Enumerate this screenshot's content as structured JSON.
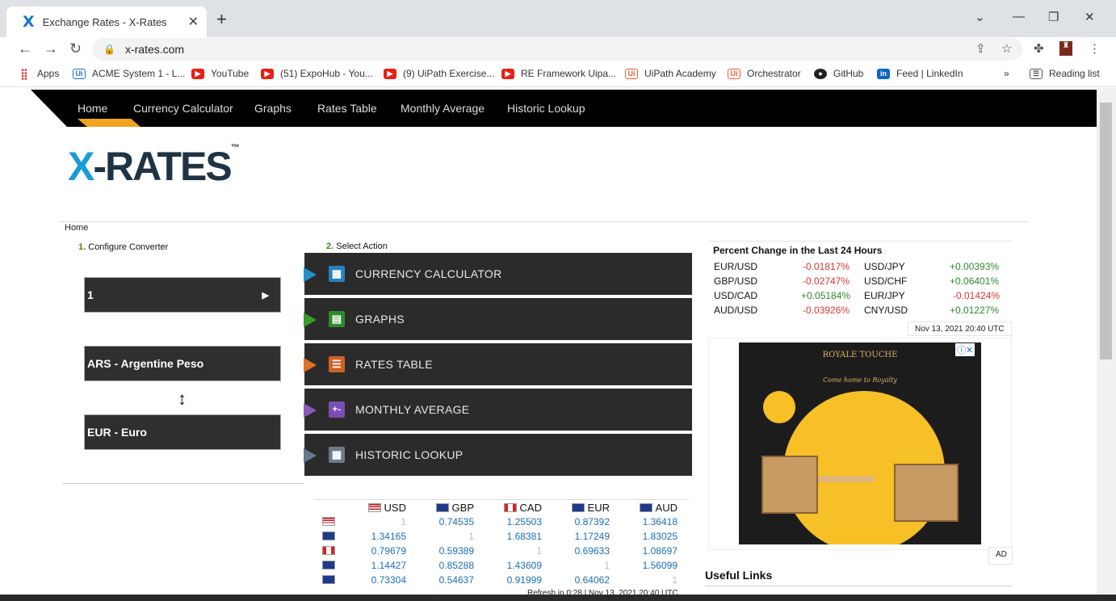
{
  "browser": {
    "tab_title": "Exchange Rates - X-Rates",
    "tab_logo": "X",
    "url": "x-rates.com",
    "bookmarks": [
      {
        "label": "Apps",
        "icon": "apps"
      },
      {
        "label": "ACME System 1 - L...",
        "icon": "ui2"
      },
      {
        "label": "YouTube",
        "icon": "yt"
      },
      {
        "label": "(51) ExpoHub - You...",
        "icon": "yt"
      },
      {
        "label": "(9) UiPath Exercise...",
        "icon": "yt"
      },
      {
        "label": "RE Framework Uipa...",
        "icon": "yt"
      },
      {
        "label": "UiPath Academy",
        "icon": "ui"
      },
      {
        "label": "Orchestrator",
        "icon": "ui"
      },
      {
        "label": "GitHub",
        "icon": "gh"
      },
      {
        "label": "Feed | LinkedIn",
        "icon": "li"
      }
    ],
    "more_bookmarks": "»",
    "reading_list": "Reading list"
  },
  "nav": {
    "items": [
      "Home",
      "Currency Calculator",
      "Graphs",
      "Rates Table",
      "Monthly Average",
      "Historic Lookup"
    ]
  },
  "logo": {
    "x": "X",
    "rest": "-RATES",
    "tm": "™"
  },
  "breadcrumb": "Home",
  "converter": {
    "step_num": "1.",
    "step_label": " Configure Converter",
    "amount": "1",
    "from": "ARS - Argentine Peso",
    "to": "EUR - Euro",
    "swap_icon": "↕"
  },
  "actions": {
    "step_num": "2.",
    "step_label": " Select Action",
    "items": [
      {
        "label": "CURRENCY CALCULATOR",
        "color": "#2290c8",
        "icon_bg": "#2a7fc0",
        "glyph": "▦"
      },
      {
        "label": "GRAPHS",
        "color": "#3a9a2a",
        "icon_bg": "#2f8a2a",
        "glyph": "▤"
      },
      {
        "label": "RATES TABLE",
        "color": "#e0702a",
        "icon_bg": "#d0602a",
        "glyph": "☰"
      },
      {
        "label": "MONTHLY AVERAGE",
        "color": "#8a5bb8",
        "icon_bg": "#7a4fb0",
        "glyph": "+-"
      },
      {
        "label": "HISTORIC LOOKUP",
        "color": "#607890",
        "icon_bg": "#6a7a8a",
        "glyph": "▦"
      }
    ]
  },
  "rates_table": {
    "headers": [
      "USD",
      "GBP",
      "CAD",
      "EUR",
      "AUD"
    ],
    "rows": [
      {
        "flag": "us",
        "values": [
          "1",
          "0.74535",
          "1.25503",
          "0.87392",
          "1.36418"
        ]
      },
      {
        "flag": "gb",
        "values": [
          "1.34165",
          "1",
          "1.68381",
          "1.17249",
          "1.83025"
        ]
      },
      {
        "flag": "ca",
        "values": [
          "0.79679",
          "0.59389",
          "1",
          "0.69633",
          "1.08697"
        ]
      },
      {
        "flag": "eu",
        "values": [
          "1.14427",
          "0.85288",
          "1.43609",
          "1",
          "1.56099"
        ]
      },
      {
        "flag": "au",
        "values": [
          "0.73304",
          "0.54637",
          "0.91999",
          "0.64062",
          "1"
        ]
      }
    ],
    "refresh": "Refresh in 0:28 | Nov 13, 2021 20:40 UTC"
  },
  "percent_change": {
    "title": "Percent Change in the Last 24 Hours",
    "rows": [
      {
        "p1": "EUR/USD",
        "v1": "-0.01817%",
        "p2": "USD/JPY",
        "v2": "+0.00393%"
      },
      {
        "p1": "GBP/USD",
        "v1": "-0.02747%",
        "p2": "USD/CHF",
        "v2": "+0.06401%"
      },
      {
        "p1": "USD/CAD",
        "v1": "+0.05184%",
        "p2": "EUR/JPY",
        "v2": "-0.01424%"
      },
      {
        "p1": "AUD/USD",
        "v1": "-0.03926%",
        "p2": "CNY/USD",
        "v2": "+0.01227%"
      }
    ],
    "timestamp": "Nov 13, 2021 20:40 UTC"
  },
  "ad": {
    "brand": "ROYALE TOUCHE",
    "tagline": "Come home to Royalty",
    "label": "AD",
    "close": "ⓘ✕"
  },
  "useful_links": {
    "title": "Useful Links"
  }
}
